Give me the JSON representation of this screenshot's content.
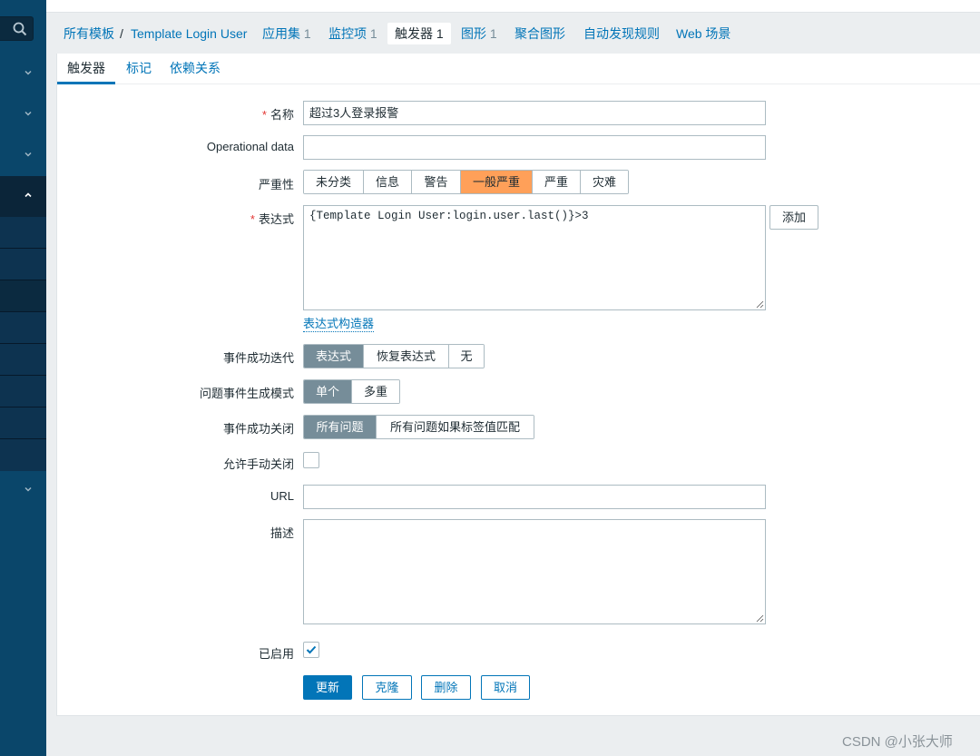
{
  "sidebar": {
    "search_icon": "search-icon",
    "menu_sections": [
      {
        "state": "collapsed",
        "icon": "chevron-down-icon"
      },
      {
        "state": "collapsed",
        "icon": "chevron-down-icon"
      },
      {
        "state": "collapsed",
        "icon": "chevron-down-icon"
      },
      {
        "state": "expanded",
        "icon": "chevron-up-icon"
      },
      {
        "state": "collapsed",
        "icon": "chevron-down-icon"
      }
    ]
  },
  "breadcrumb": {
    "all_templates": "所有模板",
    "separator": "/",
    "template_name": "Template Login User",
    "links": [
      {
        "label": "应用集",
        "count": "1"
      },
      {
        "label": "监控项",
        "count": "1"
      },
      {
        "label": "触发器",
        "count": "1",
        "active": true
      },
      {
        "label": "图形",
        "count": "1"
      },
      {
        "label": "聚合图形",
        "count": ""
      },
      {
        "label": "自动发现规则",
        "count": ""
      },
      {
        "label": "Web 场景",
        "count": ""
      }
    ]
  },
  "tabs": [
    {
      "label": "触发器",
      "active": true
    },
    {
      "label": "标记",
      "active": false
    },
    {
      "label": "依赖关系",
      "active": false
    }
  ],
  "form": {
    "required_mark": "*",
    "name": {
      "label": "名称",
      "value": "超过3人登录报警"
    },
    "operational_data": {
      "label": "Operational data",
      "value": ""
    },
    "severity": {
      "label": "严重性",
      "options": [
        "未分类",
        "信息",
        "警告",
        "一般严重",
        "严重",
        "灾难"
      ],
      "selected": "一般严重",
      "selected_color": "#ffa059"
    },
    "expression": {
      "label": "表达式",
      "value": "{Template Login User:login.user.last()}>3",
      "add_button": "添加",
      "constructor_link": "表达式构造器"
    },
    "ok_event_generation": {
      "label": "事件成功迭代",
      "options": [
        "表达式",
        "恢复表达式",
        "无"
      ],
      "selected": "表达式"
    },
    "problem_event_mode": {
      "label": "问题事件生成模式",
      "options": [
        "单个",
        "多重"
      ],
      "selected": "单个"
    },
    "ok_event_closes": {
      "label": "事件成功关闭",
      "options": [
        "所有问题",
        "所有问题如果标签值匹配"
      ],
      "selected": "所有问题"
    },
    "allow_manual_close": {
      "label": "允许手动关闭",
      "checked": false
    },
    "url": {
      "label": "URL",
      "value": ""
    },
    "description": {
      "label": "描述",
      "value": ""
    },
    "enabled": {
      "label": "已启用",
      "checked": true
    }
  },
  "actions": {
    "update": "更新",
    "clone": "克隆",
    "delete": "删除",
    "cancel": "取消"
  },
  "colors": {
    "sidebar_bg": "#0a466a",
    "accent": "#0275b8",
    "selected_segment": "#768d99"
  },
  "watermark": "CSDN @小张大师"
}
